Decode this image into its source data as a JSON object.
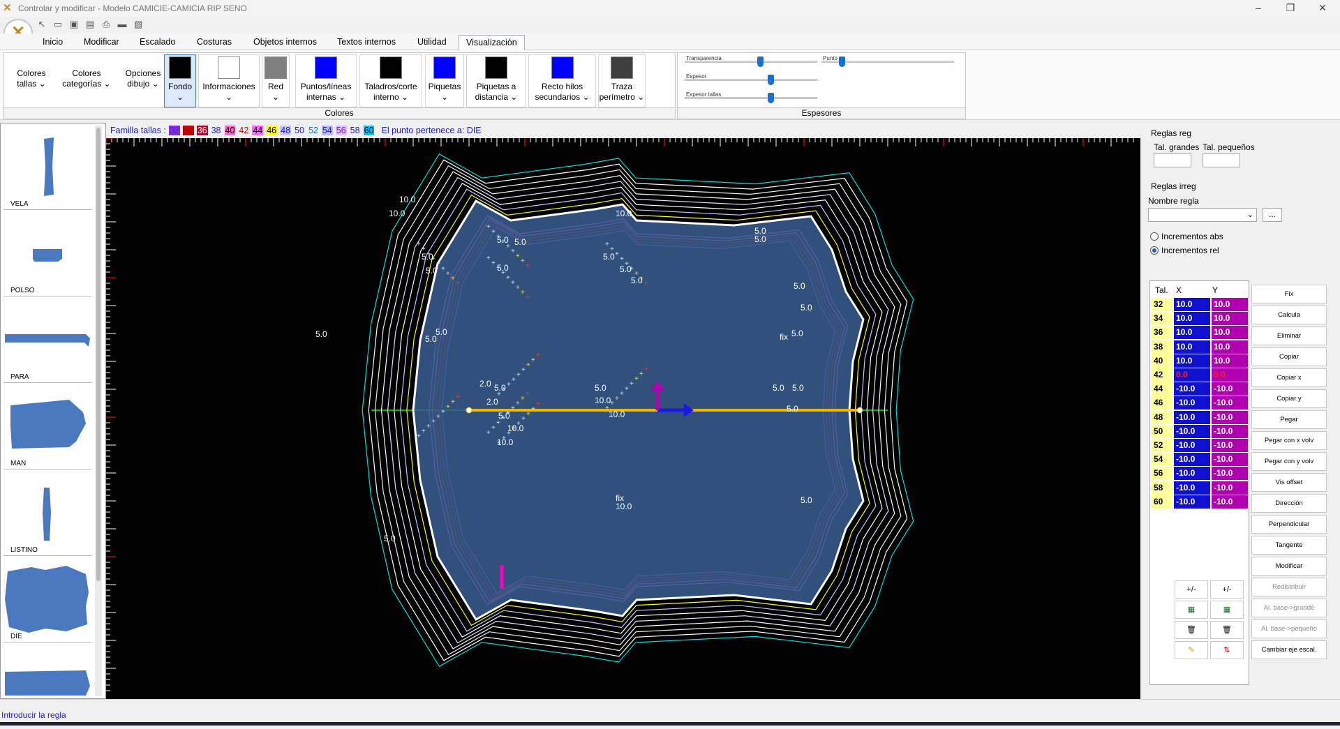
{
  "window": {
    "title": "Controlar y modificar - Modelo CAMICIE-CAMICIA RIP SENO"
  },
  "ribbon": {
    "tabs": [
      "Inicio",
      "Modificar",
      "Escalado",
      "Costuras",
      "Objetos internos",
      "Textos internos",
      "Utilidad",
      "Visualización"
    ],
    "active_tab": "Visualización",
    "colores_group": {
      "label": "Colores",
      "buttons": [
        {
          "line1": "Colores",
          "line2": "tallas ⌄"
        },
        {
          "line1": "Colores",
          "line2": "categorías ⌄"
        },
        {
          "line1": "Opciones",
          "line2": "dibujo ⌄"
        }
      ],
      "swatches": [
        {
          "line1": "Fondo",
          "line2": "⌄",
          "color": "#000000"
        },
        {
          "line1": "Informaciones",
          "line2": "⌄",
          "color": "#ffffff"
        },
        {
          "line1": "Red",
          "line2": "⌄",
          "color": "#808080"
        },
        {
          "line1": "Puntos/líneas",
          "line2": "internas ⌄",
          "color": "#0000ff"
        },
        {
          "line1": "Taladros/corte",
          "line2": "interno ⌄",
          "color": "#000000"
        },
        {
          "line1": "Piquetas",
          "line2": "⌄",
          "color": "#0000ff"
        },
        {
          "line1": "Piquetas a",
          "line2": "distancia ⌄",
          "color": "#000000"
        },
        {
          "line1": "Recto hilos",
          "line2": "secundarios ⌄",
          "color": "#0000ff"
        },
        {
          "line1": "Traza",
          "line2": "perímetro ⌄",
          "color": "#404040"
        }
      ]
    },
    "espesores_group": {
      "label": "Espesores",
      "sliders": [
        "Transparencia",
        "Punto",
        "Espesor",
        "Espesor tallas"
      ],
      "levels": [
        0.6,
        0.15,
        0.65,
        0.65
      ]
    }
  },
  "familia_bar": {
    "label": "Familla tallas :",
    "sizes": [
      {
        "t": "32",
        "fg": "#5a1fd0",
        "bg": "#8a2be2"
      },
      {
        "t": "34",
        "fg": "#c00000",
        "bg": "#c00000"
      },
      {
        "t": "36",
        "fg": "#ffffff",
        "bg": "#c0002a"
      },
      {
        "t": "38",
        "fg": "#1c1cc0",
        "bg": ""
      },
      {
        "t": "40",
        "fg": "#000000",
        "bg": "#ff66cc"
      },
      {
        "t": "42",
        "fg": "#e00000",
        "bg": ""
      },
      {
        "t": "44",
        "fg": "#000000",
        "bg": "#ff66ff"
      },
      {
        "t": "46",
        "fg": "#000000",
        "bg": "#ffff00"
      },
      {
        "t": "48",
        "fg": "#1c1cc0",
        "bg": "#c8c8ff"
      },
      {
        "t": "50",
        "fg": "#1c1cc0",
        "bg": ""
      },
      {
        "t": "52",
        "fg": "#0080c0",
        "bg": ""
      },
      {
        "t": "54",
        "fg": "#1c1cc0",
        "bg": "#b9b9ff"
      },
      {
        "t": "56",
        "fg": "#7a1ad0",
        "bg": "#e0c0ff"
      },
      {
        "t": "58",
        "fg": "#1c1cc0",
        "bg": ""
      },
      {
        "t": "60",
        "fg": "#000000",
        "bg": "#00c0ff"
      }
    ],
    "punto_text": "El punto pertenece a: DIE"
  },
  "pieces": [
    "VELA",
    "POLSO",
    "PARA",
    "MAN",
    "LISTINO",
    "DIE"
  ],
  "canvas": {
    "labels": [
      "10.0",
      "10.0",
      "10.0",
      "5.0",
      "5.0",
      "5.0",
      "5.0",
      "5.0",
      "5.0",
      "5.0",
      "5.0",
      "5.0",
      "5.0",
      "5.0",
      "5.0",
      "5.0",
      "5.0",
      "5.0",
      "5.0",
      "5.0",
      "2.0",
      "2.0",
      "5.0",
      "5.0",
      "10.0",
      "10.0",
      "10.0",
      "10.0",
      "5.0",
      "5.0",
      "fix",
      "fix",
      "10.0",
      "5.0",
      "5.0",
      "5.0"
    ]
  },
  "right_panel": {
    "reglas_reg": "Reglas reg",
    "tal_grandes": "Tal. grandes",
    "tal_pequenos": "Tal. pequeños",
    "reglas_irreg": "Reglas irreg",
    "nombre_regla": "Nombre regla",
    "browse": "...",
    "inc_abs": "Incrementos abs",
    "inc_rel": "Incrementos rel",
    "table_headers": [
      "Tal.",
      "X",
      "Y"
    ],
    "rows": [
      {
        "tal": "32",
        "x": "10.0",
        "y": "10.0"
      },
      {
        "tal": "34",
        "x": "10.0",
        "y": "10.0"
      },
      {
        "tal": "36",
        "x": "10.0",
        "y": "10.0"
      },
      {
        "tal": "38",
        "x": "10.0",
        "y": "10.0"
      },
      {
        "tal": "40",
        "x": "10.0",
        "y": "10.0"
      },
      {
        "tal": "42",
        "x": "0.0",
        "y": "0.0"
      },
      {
        "tal": "44",
        "x": "-10.0",
        "y": "-10.0"
      },
      {
        "tal": "46",
        "x": "-10.0",
        "y": "-10.0"
      },
      {
        "tal": "48",
        "x": "-10.0",
        "y": "-10.0"
      },
      {
        "tal": "50",
        "x": "-10.0",
        "y": "-10.0"
      },
      {
        "tal": "52",
        "x": "-10.0",
        "y": "-10.0"
      },
      {
        "tal": "54",
        "x": "-10.0",
        "y": "-10.0"
      },
      {
        "tal": "56",
        "x": "-10.0",
        "y": "-10.0"
      },
      {
        "tal": "58",
        "x": "-10.0",
        "y": "-10.0"
      },
      {
        "tal": "60",
        "x": "-10.0",
        "y": "-10.0"
      }
    ],
    "actions": [
      "Fix",
      "Calcula",
      "Eliminar",
      "Copiar",
      "Copiar x",
      "Copiar y",
      "Pegar",
      "Pegar con x volv",
      "Pegar con y volv",
      "Vis offset",
      "Dirección",
      "Perpendicular",
      "Tangente",
      "Modificar",
      "Redistribuir",
      "Al. base->grande",
      "Al. base->pequeño",
      "Cambiar eje escal."
    ],
    "disabled_actions": [
      "Redistribuir",
      "Al. base->grande",
      "Al. base->pequeño"
    ],
    "plus_minus": "+/-"
  },
  "status": {
    "text": "Introducir la regla"
  }
}
